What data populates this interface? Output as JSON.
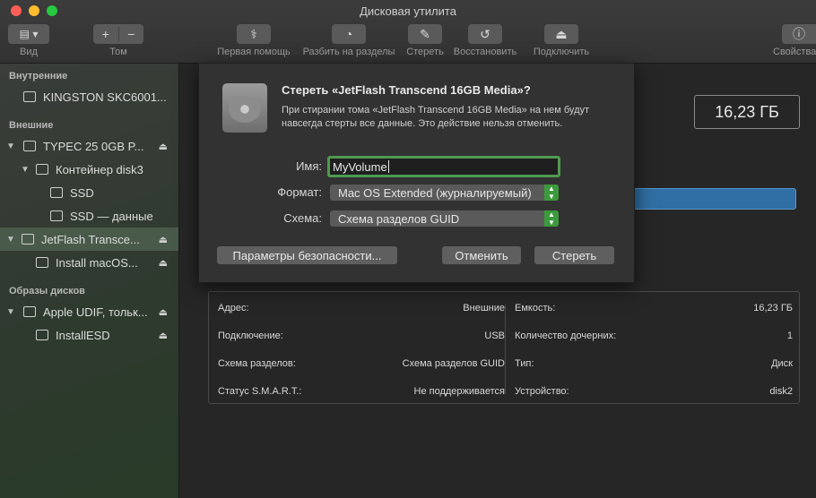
{
  "window": {
    "title": "Дисковая утилита"
  },
  "toolbar": {
    "view_label": "Вид",
    "volume_label": "Том",
    "firstaid_label": "Первая помощь",
    "partition_label": "Разбить на разделы",
    "erase_label": "Стереть",
    "restore_label": "Восстановить",
    "mount_label": "Подключить",
    "info_label": "Свойства"
  },
  "sidebar": {
    "section_internal": "Внутренние",
    "section_external": "Внешние",
    "section_images": "Образы дисков",
    "items": [
      {
        "label": "KINGSTON SKC6001..."
      },
      {
        "label": "TYPEC 25 0GB P..."
      },
      {
        "label": "Контейнер disk3"
      },
      {
        "label": "SSD"
      },
      {
        "label": "SSD — данные"
      },
      {
        "label": "JetFlash Transce..."
      },
      {
        "label": "Install macOS..."
      },
      {
        "label": "Apple UDIF, тольк..."
      },
      {
        "label": "InstallESD"
      }
    ],
    "eject_glyph": "⏏"
  },
  "main": {
    "capacity": "16,23 ГБ"
  },
  "info": {
    "left": [
      {
        "key": "Адрес:",
        "value": "Внешние"
      },
      {
        "key": "Подключение:",
        "value": "USB"
      },
      {
        "key": "Схема разделов:",
        "value": "Схема разделов GUID"
      },
      {
        "key": "Статус S.M.A.R.T.:",
        "value": "Не поддерживается"
      }
    ],
    "right": [
      {
        "key": "Емкость:",
        "value": "16,23 ГБ"
      },
      {
        "key": "Количество дочерних:",
        "value": "1"
      },
      {
        "key": "Тип:",
        "value": "Диск"
      },
      {
        "key": "Устройство:",
        "value": "disk2"
      }
    ]
  },
  "dialog": {
    "title": "Стереть «JetFlash Transcend 16GB Media»?",
    "text": "При стирании тома «JetFlash Transcend 16GB Media» на нем будут навсегда стерты все данные. Это действие нельзя отменить.",
    "name_label": "Имя:",
    "name_value": "MyVolume",
    "format_label": "Формат:",
    "format_value": "Mac OS Extended (журналируемый)",
    "scheme_label": "Схема:",
    "scheme_value": "Схема разделов GUID",
    "security_button": "Параметры безопасности...",
    "cancel_button": "Отменить",
    "erase_button": "Стереть"
  },
  "colors": {
    "accent_green": "#4e9a4e",
    "bar_blue": "#2f6fa3"
  }
}
